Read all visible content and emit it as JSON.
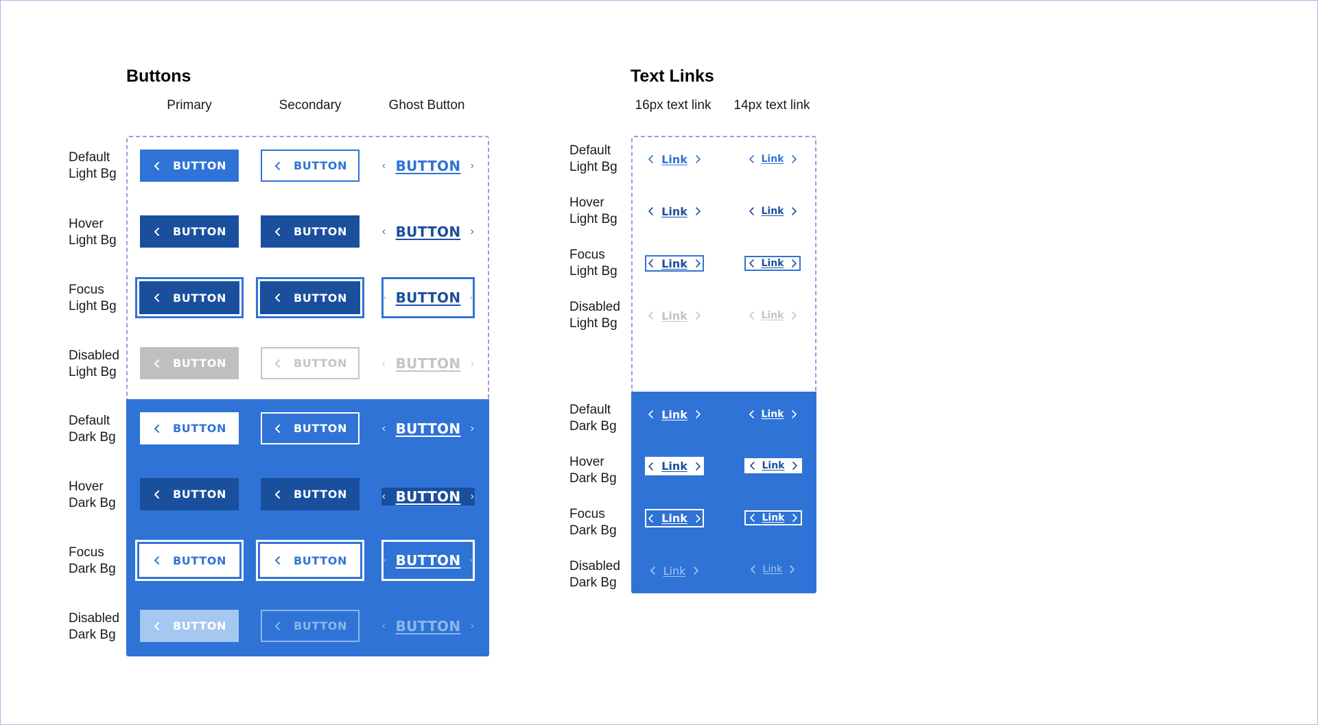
{
  "buttons": {
    "title": "Buttons",
    "columns": {
      "primary": "Primary",
      "secondary": "Secondary",
      "ghost": "Ghost Button"
    },
    "button_label": "BUTTON",
    "rows": [
      {
        "line1": "Default",
        "line2": "Light Bg"
      },
      {
        "line1": "Hover",
        "line2": "Light Bg"
      },
      {
        "line1": "Focus",
        "line2": "Light Bg"
      },
      {
        "line1": "Disabled",
        "line2": "Light Bg"
      },
      {
        "line1": "Default",
        "line2": "Dark Bg"
      },
      {
        "line1": "Hover",
        "line2": "Dark Bg"
      },
      {
        "line1": "Focus",
        "line2": "Dark Bg"
      },
      {
        "line1": "Disabled",
        "line2": "Dark Bg"
      }
    ]
  },
  "text_links": {
    "title": "Text Links",
    "columns": {
      "size16": "16px text link",
      "size14": "14px text link"
    },
    "link_label": "Link",
    "rows": [
      {
        "line1": "Default",
        "line2": "Light Bg"
      },
      {
        "line1": "Hover",
        "line2": "Light Bg"
      },
      {
        "line1": "Focus",
        "line2": "Light Bg"
      },
      {
        "line1": "Disabled",
        "line2": "Light Bg"
      },
      {
        "line1": "Default",
        "line2": "Dark Bg"
      },
      {
        "line1": "Hover",
        "line2": "Dark Bg"
      },
      {
        "line1": "Focus",
        "line2": "Dark Bg"
      },
      {
        "line1": "Disabled",
        "line2": "Dark Bg"
      }
    ]
  },
  "colors": {
    "primary_blue": "#2f73d6",
    "hover_blue": "#1a4f9e",
    "disabled_gray": "#bfbfbf",
    "disabled_light_blue": "#a5c7f0",
    "guide_dashed": "#b78ae6"
  },
  "icons": {
    "leading": "chevron-left-icon",
    "trailing": "chevron-right-icon"
  }
}
